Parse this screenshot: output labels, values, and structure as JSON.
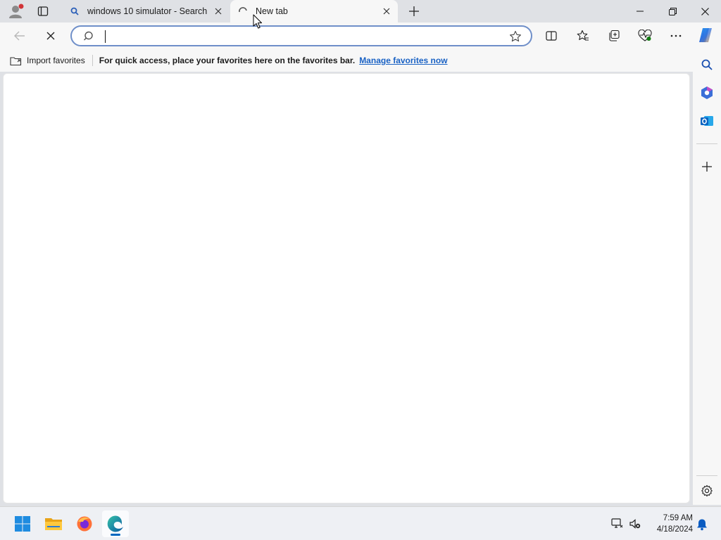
{
  "window": {
    "tabs": [
      {
        "title": "windows 10 simulator - Search",
        "favicon": "search-icon",
        "active": false
      },
      {
        "title": "New tab",
        "favicon": "loading-spinner-icon",
        "active": true
      }
    ],
    "controls": [
      "minimize-icon",
      "restore-icon",
      "close-icon"
    ]
  },
  "toolbar": {
    "address": {
      "value": "",
      "placeholder": ""
    },
    "buttons": [
      "back-icon",
      "stop-icon",
      "split-screen-icon",
      "favorites-icon",
      "collections-icon",
      "browser-essentials-icon",
      "more-icon",
      "copilot-icon"
    ]
  },
  "favorites_bar": {
    "import_label": "Import favorites",
    "message": "For quick access, place your favorites here on the favorites bar.",
    "link": "Manage favorites now"
  },
  "sidebar": {
    "items": [
      "search-icon",
      "copilot-apps-icon",
      "outlook-icon",
      "add-icon",
      "settings-icon"
    ]
  },
  "taskbar": {
    "apps": [
      "start-icon",
      "file-explorer-icon",
      "firefox-icon",
      "edge-icon"
    ],
    "time": "7:59 AM",
    "date": "4/18/2024"
  },
  "colors": {
    "accent": "#0067c0",
    "link": "#1a62c4",
    "address_border": "#6f8fc9",
    "chrome_bg": "#dfe1e5",
    "toolbar_bg": "#f7f7f7"
  }
}
